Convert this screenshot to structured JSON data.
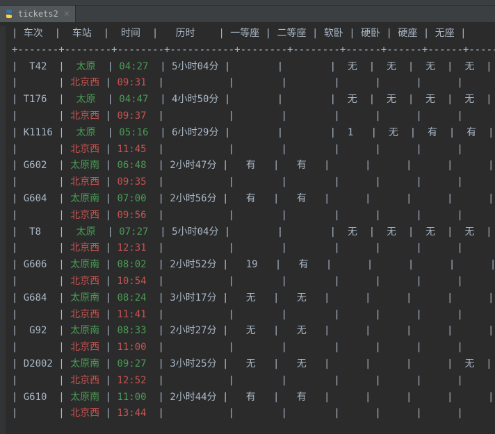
{
  "tab": {
    "filename": "tickets2",
    "icon": "python-icon",
    "close_glyph": "×"
  },
  "table": {
    "headers": [
      "车次",
      "车站",
      "时间",
      "历时",
      "一等座",
      "二等座",
      "软卧",
      "硬卧",
      "硬座",
      "无座"
    ],
    "rows": [
      {
        "train": "T42",
        "depart_station": "太原",
        "arrive_station": "北京西",
        "depart_time": "04:27",
        "arrive_time": "09:31",
        "duration": "5小时04分",
        "first": "",
        "second": "",
        "soft_sleeper": "无",
        "hard_sleeper": "无",
        "hard_seat": "无",
        "no_seat": "无"
      },
      {
        "train": "T176",
        "depart_station": "太原",
        "arrive_station": "北京西",
        "depart_time": "04:47",
        "arrive_time": "09:37",
        "duration": "4小时50分",
        "first": "",
        "second": "",
        "soft_sleeper": "无",
        "hard_sleeper": "无",
        "hard_seat": "无",
        "no_seat": "无"
      },
      {
        "train": "K1116",
        "depart_station": "太原",
        "arrive_station": "北京西",
        "depart_time": "05:16",
        "arrive_time": "11:45",
        "duration": "6小时29分",
        "first": "",
        "second": "",
        "soft_sleeper": "1",
        "hard_sleeper": "无",
        "hard_seat": "有",
        "no_seat": "有"
      },
      {
        "train": "G602",
        "depart_station": "太原南",
        "arrive_station": "北京西",
        "depart_time": "06:48",
        "arrive_time": "09:35",
        "duration": "2小时47分",
        "first": "有",
        "second": "有",
        "soft_sleeper": "",
        "hard_sleeper": "",
        "hard_seat": "",
        "no_seat": ""
      },
      {
        "train": "G604",
        "depart_station": "太原南",
        "arrive_station": "北京西",
        "depart_time": "07:00",
        "arrive_time": "09:56",
        "duration": "2小时56分",
        "first": "有",
        "second": "有",
        "soft_sleeper": "",
        "hard_sleeper": "",
        "hard_seat": "",
        "no_seat": ""
      },
      {
        "train": "T8",
        "depart_station": "太原",
        "arrive_station": "北京西",
        "depart_time": "07:27",
        "arrive_time": "12:31",
        "duration": "5小时04分",
        "first": "",
        "second": "",
        "soft_sleeper": "无",
        "hard_sleeper": "无",
        "hard_seat": "无",
        "no_seat": "无"
      },
      {
        "train": "G606",
        "depart_station": "太原南",
        "arrive_station": "北京西",
        "depart_time": "08:02",
        "arrive_time": "10:54",
        "duration": "2小时52分",
        "first": "19",
        "second": "有",
        "soft_sleeper": "",
        "hard_sleeper": "",
        "hard_seat": "",
        "no_seat": ""
      },
      {
        "train": "G684",
        "depart_station": "太原南",
        "arrive_station": "北京西",
        "depart_time": "08:24",
        "arrive_time": "11:41",
        "duration": "3小时17分",
        "first": "无",
        "second": "无",
        "soft_sleeper": "",
        "hard_sleeper": "",
        "hard_seat": "",
        "no_seat": ""
      },
      {
        "train": "G92",
        "depart_station": "太原南",
        "arrive_station": "北京西",
        "depart_time": "08:33",
        "arrive_time": "11:00",
        "duration": "2小时27分",
        "first": "无",
        "second": "无",
        "soft_sleeper": "",
        "hard_sleeper": "",
        "hard_seat": "",
        "no_seat": ""
      },
      {
        "train": "D2002",
        "depart_station": "太原南",
        "arrive_station": "北京西",
        "depart_time": "09:27",
        "arrive_time": "12:52",
        "duration": "3小时25分",
        "first": "无",
        "second": "无",
        "soft_sleeper": "",
        "hard_sleeper": "",
        "hard_seat": "",
        "no_seat": "无"
      },
      {
        "train": "G610",
        "depart_station": "太原南",
        "arrive_station": "北京西",
        "depart_time": "11:00",
        "arrive_time": "13:44",
        "duration": "2小时44分",
        "first": "有",
        "second": "有",
        "soft_sleeper": "",
        "hard_sleeper": "",
        "hard_seat": "",
        "no_seat": ""
      }
    ]
  }
}
